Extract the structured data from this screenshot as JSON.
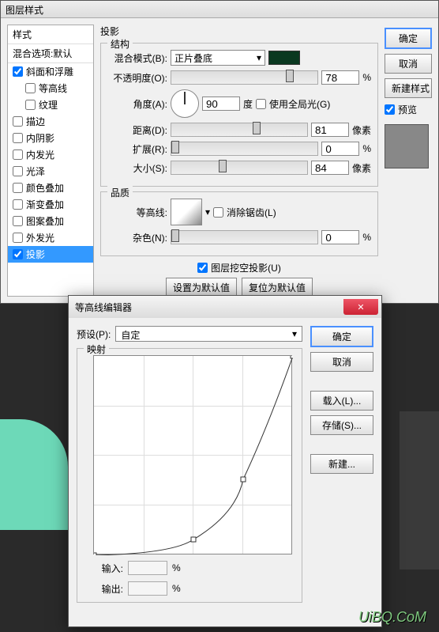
{
  "mainWindow": {
    "title": "图层样式",
    "stylesHeader1": "样式",
    "stylesHeader2": "混合选项:默认",
    "styleItems": [
      {
        "label": "斜面和浮雕",
        "checked": true
      },
      {
        "label": "等高线",
        "checked": false
      },
      {
        "label": "纹理",
        "checked": false
      },
      {
        "label": "描边",
        "checked": false
      },
      {
        "label": "内阴影",
        "checked": false
      },
      {
        "label": "内发光",
        "checked": false
      },
      {
        "label": "光泽",
        "checked": false
      },
      {
        "label": "颜色叠加",
        "checked": false
      },
      {
        "label": "渐变叠加",
        "checked": false
      },
      {
        "label": "图案叠加",
        "checked": false
      },
      {
        "label": "外发光",
        "checked": false
      },
      {
        "label": "投影",
        "checked": true,
        "selected": true
      }
    ],
    "section": {
      "title": "投影",
      "structure": "结构",
      "quality": "品质",
      "blendMode": {
        "label": "混合模式(B):",
        "value": "正片叠底"
      },
      "opacity": {
        "label": "不透明度(O):",
        "value": "78",
        "unit": "%"
      },
      "angle": {
        "label": "角度(A):",
        "value": "90",
        "unit": "度",
        "globalLight": "使用全局光(G)"
      },
      "distance": {
        "label": "距离(D):",
        "value": "81",
        "unit": "像素"
      },
      "spread": {
        "label": "扩展(R):",
        "value": "0",
        "unit": "%"
      },
      "size": {
        "label": "大小(S):",
        "value": "84",
        "unit": "像素"
      },
      "contour": {
        "label": "等高线:",
        "antialias": "消除锯齿(L)"
      },
      "noise": {
        "label": "杂色(N):",
        "value": "0",
        "unit": "%"
      },
      "knockout": "图层挖空投影(U)",
      "btnDefault": "设置为默认值",
      "btnReset": "复位为默认值"
    },
    "buttons": {
      "ok": "确定",
      "cancel": "取消",
      "newStyle": "新建样式",
      "preview": "预览"
    }
  },
  "curveWindow": {
    "title": "等高线编辑器",
    "preset": {
      "label": "预设(P):",
      "value": "自定"
    },
    "mapping": "映射",
    "input": {
      "label": "输入:",
      "unit": "%"
    },
    "output": {
      "label": "输出:",
      "unit": "%"
    },
    "buttons": {
      "ok": "确定",
      "cancel": "取消",
      "load": "载入(L)...",
      "save": "存储(S)...",
      "new": "新建..."
    }
  },
  "chart_data": {
    "type": "line",
    "title": "映射",
    "xlabel": "输入",
    "ylabel": "输出",
    "x": [
      0,
      50,
      75,
      100
    ],
    "values": [
      0,
      8,
      38,
      100
    ],
    "xlim": [
      0,
      100
    ],
    "ylim": [
      0,
      100
    ]
  },
  "watermark": "UiBQ.CoM"
}
